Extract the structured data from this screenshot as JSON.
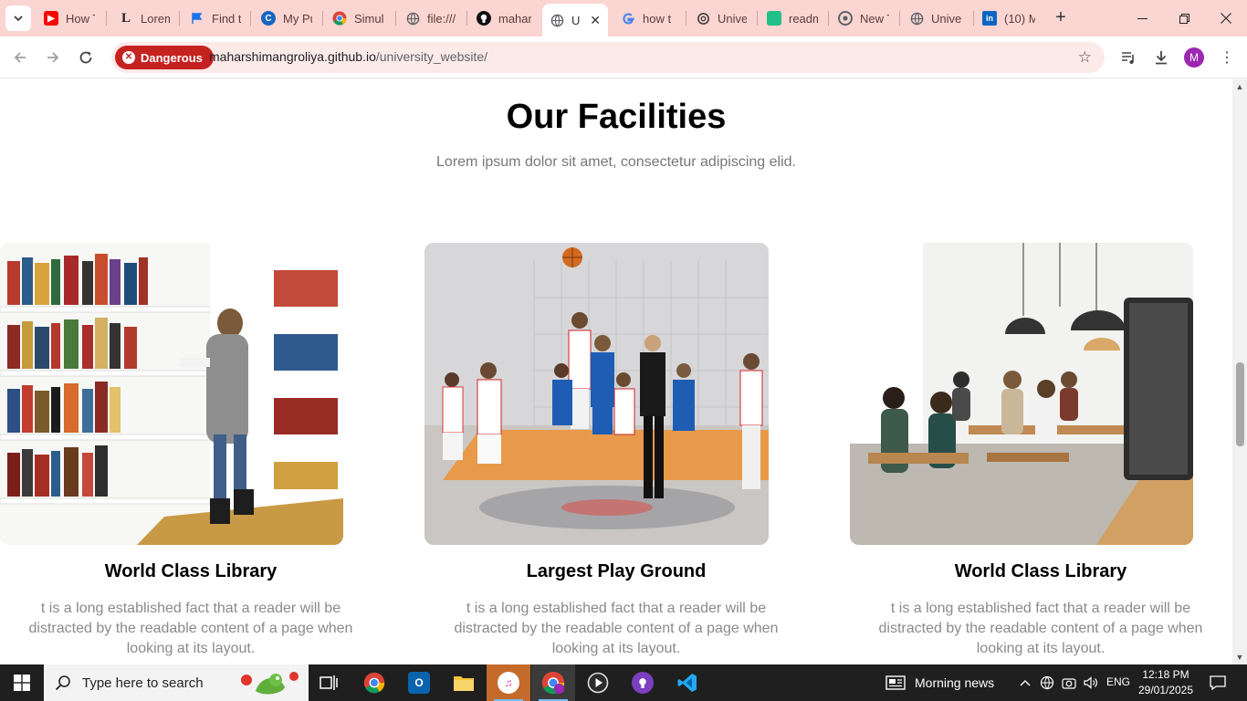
{
  "browser": {
    "tabs": [
      {
        "label": "How T",
        "icon": "youtube-icon",
        "color": "#ff0000"
      },
      {
        "label": "Lorem",
        "icon": "lipsum-icon",
        "color": "#333333"
      },
      {
        "label": "Find t",
        "icon": "flag-icon",
        "color": "#1a73e8"
      },
      {
        "label": "My Pu",
        "icon": "c-icon",
        "color": "#1565c0"
      },
      {
        "label": "Simul",
        "icon": "chrome-icon",
        "color": "#34a853"
      },
      {
        "label": "file:///",
        "icon": "globe-icon",
        "color": "#5f6368"
      },
      {
        "label": "mahar",
        "icon": "github-icon",
        "color": "#111111"
      },
      {
        "label": "U",
        "icon": "globe-icon",
        "color": "#5f6368"
      },
      {
        "label": "how t",
        "icon": "google-icon",
        "color": "#4285f4"
      },
      {
        "label": "Unive",
        "icon": "chatgpt-icon",
        "color": "#333333"
      },
      {
        "label": "readm",
        "icon": "sheet-icon",
        "color": "#21c08b"
      },
      {
        "label": "New T",
        "icon": "chrome-icon",
        "color": "#5f6368"
      },
      {
        "label": "Unive",
        "icon": "globe-icon",
        "color": "#5f6368"
      },
      {
        "label": "(10) M",
        "icon": "linkedin-icon",
        "color": "#0a66c2"
      }
    ],
    "active_tab_index": 7,
    "security_label": "Dangerous",
    "url_host": "maharshimangroliya.github.io",
    "url_path": "/university_website/",
    "profile_initial": "M"
  },
  "page": {
    "title": "Our Facilities",
    "subtitle": "Lorem ipsum dolor sit amet, consectetur adipiscing elid.",
    "cards": [
      {
        "title": "World Class Library",
        "text": "t is a long established fact that a reader will be distracted by the readable content of a page when looking at its layout.",
        "image": "library-photo"
      },
      {
        "title": "Largest Play Ground",
        "text": "t is a long established fact that a reader will be distracted by the readable content of a page when looking at its layout.",
        "image": "basketball-photo"
      },
      {
        "title": "World Class Library",
        "text": "t is a long established fact that a reader will be distracted by the readable content of a page when looking at its layout.",
        "image": "cafe-photo"
      }
    ]
  },
  "taskbar": {
    "search_placeholder": "Type here to search",
    "news_label": "Morning news",
    "language": "ENG",
    "time": "12:18 PM",
    "date": "29/01/2025",
    "apps": [
      "task-view-icon",
      "chrome-icon",
      "outlook-icon",
      "file-explorer-icon",
      "itunes-icon",
      "chrome-profile-icon",
      "media-player-icon",
      "github-desktop-icon",
      "vscode-icon"
    ]
  }
}
